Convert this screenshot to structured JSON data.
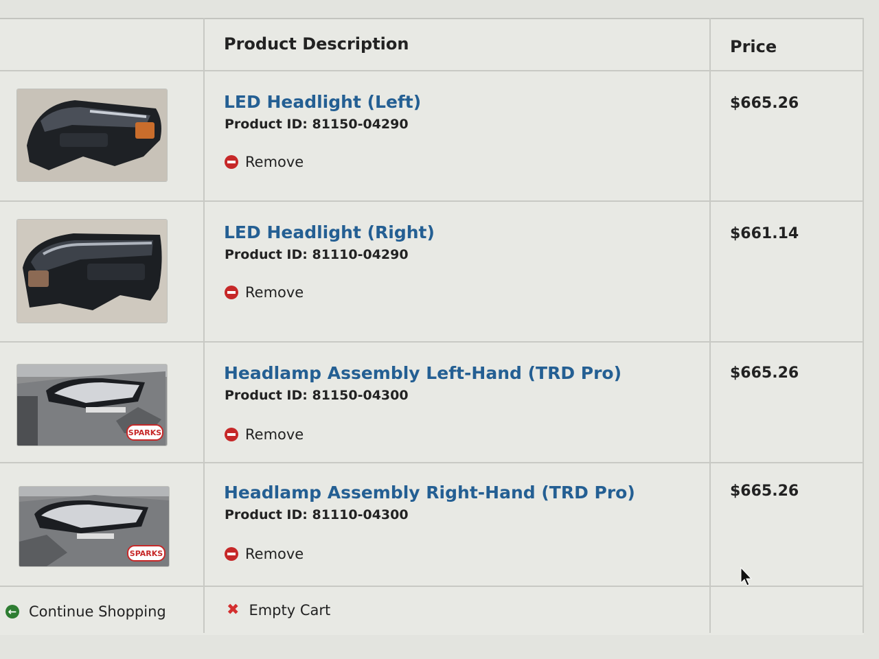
{
  "table": {
    "headers": {
      "description": "Product Description",
      "price": "Price"
    },
    "items": [
      {
        "name": "LED Headlight (Left)",
        "product_id": "Product ID: 81150-04290",
        "remove_label": "Remove",
        "price": "$665.26",
        "image_icon": "headlight-product-photo"
      },
      {
        "name": "LED Headlight (Right)",
        "product_id": "Product ID: 81110-04290",
        "remove_label": "Remove",
        "price": "$661.14",
        "image_icon": "headlight-product-photo"
      },
      {
        "name": "Headlamp Assembly Left-Hand (TRD Pro)",
        "product_id": "Product ID: 81150-04300",
        "remove_label": "Remove",
        "price": "$665.26",
        "image_icon": "headlamp-on-truck-photo",
        "watermark": "SPARKS"
      },
      {
        "name": "Headlamp Assembly Right-Hand (TRD Pro)",
        "product_id": "Product ID: 81110-04300",
        "remove_label": "Remove",
        "price": "$665.26",
        "image_icon": "headlamp-on-truck-photo",
        "watermark": "SPARKS"
      }
    ],
    "footer": {
      "continue_label": "Continue Shopping",
      "empty_label": "Empty Cart"
    }
  },
  "icons": {
    "remove": "minus-circle-icon",
    "continue": "arrow-left-circle-icon",
    "empty": "x-icon",
    "pointer": "mouse-cursor-icon"
  },
  "colors": {
    "link_blue": "#245f93",
    "remove_red": "#c62828",
    "continue_green": "#2e7d32"
  }
}
